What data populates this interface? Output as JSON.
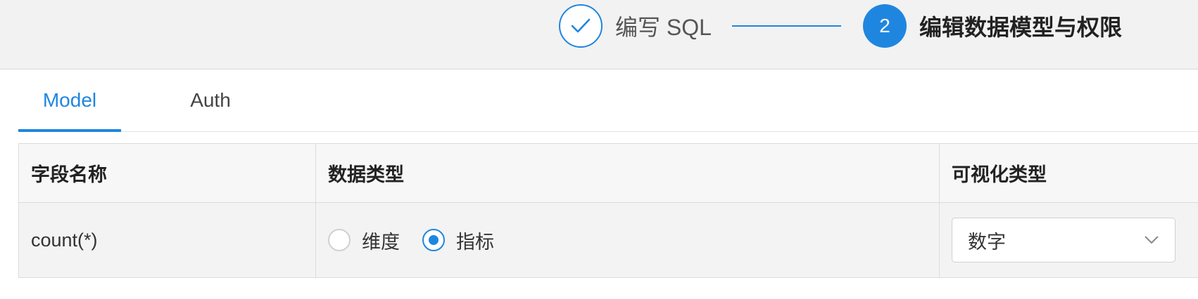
{
  "steps": [
    {
      "label": "编写 SQL",
      "status": "done",
      "icon": "check-icon"
    },
    {
      "number": "2",
      "label": "编辑数据模型与权限",
      "status": "active"
    }
  ],
  "colors": {
    "accent": "#1f86e0",
    "header_bg": "#f2f2f2"
  },
  "tabs": [
    {
      "label": "Model",
      "active": true
    },
    {
      "label": "Auth",
      "active": false
    }
  ],
  "table": {
    "headers": [
      "字段名称",
      "数据类型",
      "可视化类型"
    ],
    "rows": [
      {
        "field_name": "count(*)",
        "data_type_options": [
          {
            "label": "维度",
            "checked": false
          },
          {
            "label": "指标",
            "checked": true
          }
        ],
        "visual_type": "数字",
        "visual_type_icon": "chevron-down-icon"
      }
    ]
  }
}
